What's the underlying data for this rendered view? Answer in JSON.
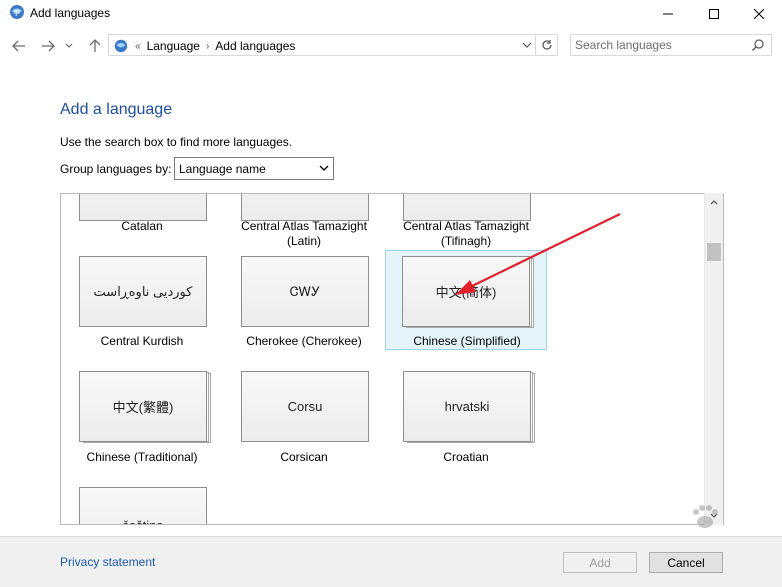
{
  "window": {
    "title": "Add languages",
    "controls": [
      "minimize",
      "maximize",
      "close"
    ]
  },
  "nav": {
    "back": "back-icon",
    "forward": "forward-icon",
    "recent": "chevron-down-icon",
    "up": "up-arrow-icon",
    "overflow": "«",
    "breadcrumb": [
      "Language",
      "Add languages"
    ]
  },
  "search": {
    "placeholder": "Search languages",
    "value": ""
  },
  "content": {
    "heading": "Add a language",
    "instructions": "Use the search box to find more languages.",
    "group_label": "Group languages by:",
    "group_value": "Language name"
  },
  "languages": [
    {
      "name": "Catalan",
      "sample": "",
      "partial": true
    },
    {
      "name": "Central Atlas Tamazight\n(Latin)",
      "sample": "",
      "partial": true
    },
    {
      "name": "Central Atlas Tamazight\n(Tifinagh)",
      "sample": "",
      "partial": true
    },
    {
      "name": "Central Kurdish",
      "sample": "کوردیی ناوەڕاست",
      "stacked": false
    },
    {
      "name": "Cherokee (Cherokee)",
      "sample": "ᏣᎳᎩ",
      "stacked": false
    },
    {
      "name": "Chinese (Simplified)",
      "sample": "中文(简体)",
      "stacked": true,
      "selected": true
    },
    {
      "name": "Chinese (Traditional)",
      "sample": "中文(繁體)",
      "stacked": true
    },
    {
      "name": "Corsican",
      "sample": "Corsu",
      "stacked": false
    },
    {
      "name": "Croatian",
      "sample": "hrvatski",
      "stacked": true
    },
    {
      "name": "",
      "sample": "čeština",
      "partial": true
    }
  ],
  "footer": {
    "privacy": "Privacy statement",
    "add": "Add",
    "cancel": "Cancel"
  },
  "colors": {
    "heading": "#1e4e9c",
    "link": "#1a5aa8",
    "selection_bg": "#e5f3fb",
    "selection_border": "#9bd3ef",
    "annotation_arrow": "#e0202a"
  }
}
